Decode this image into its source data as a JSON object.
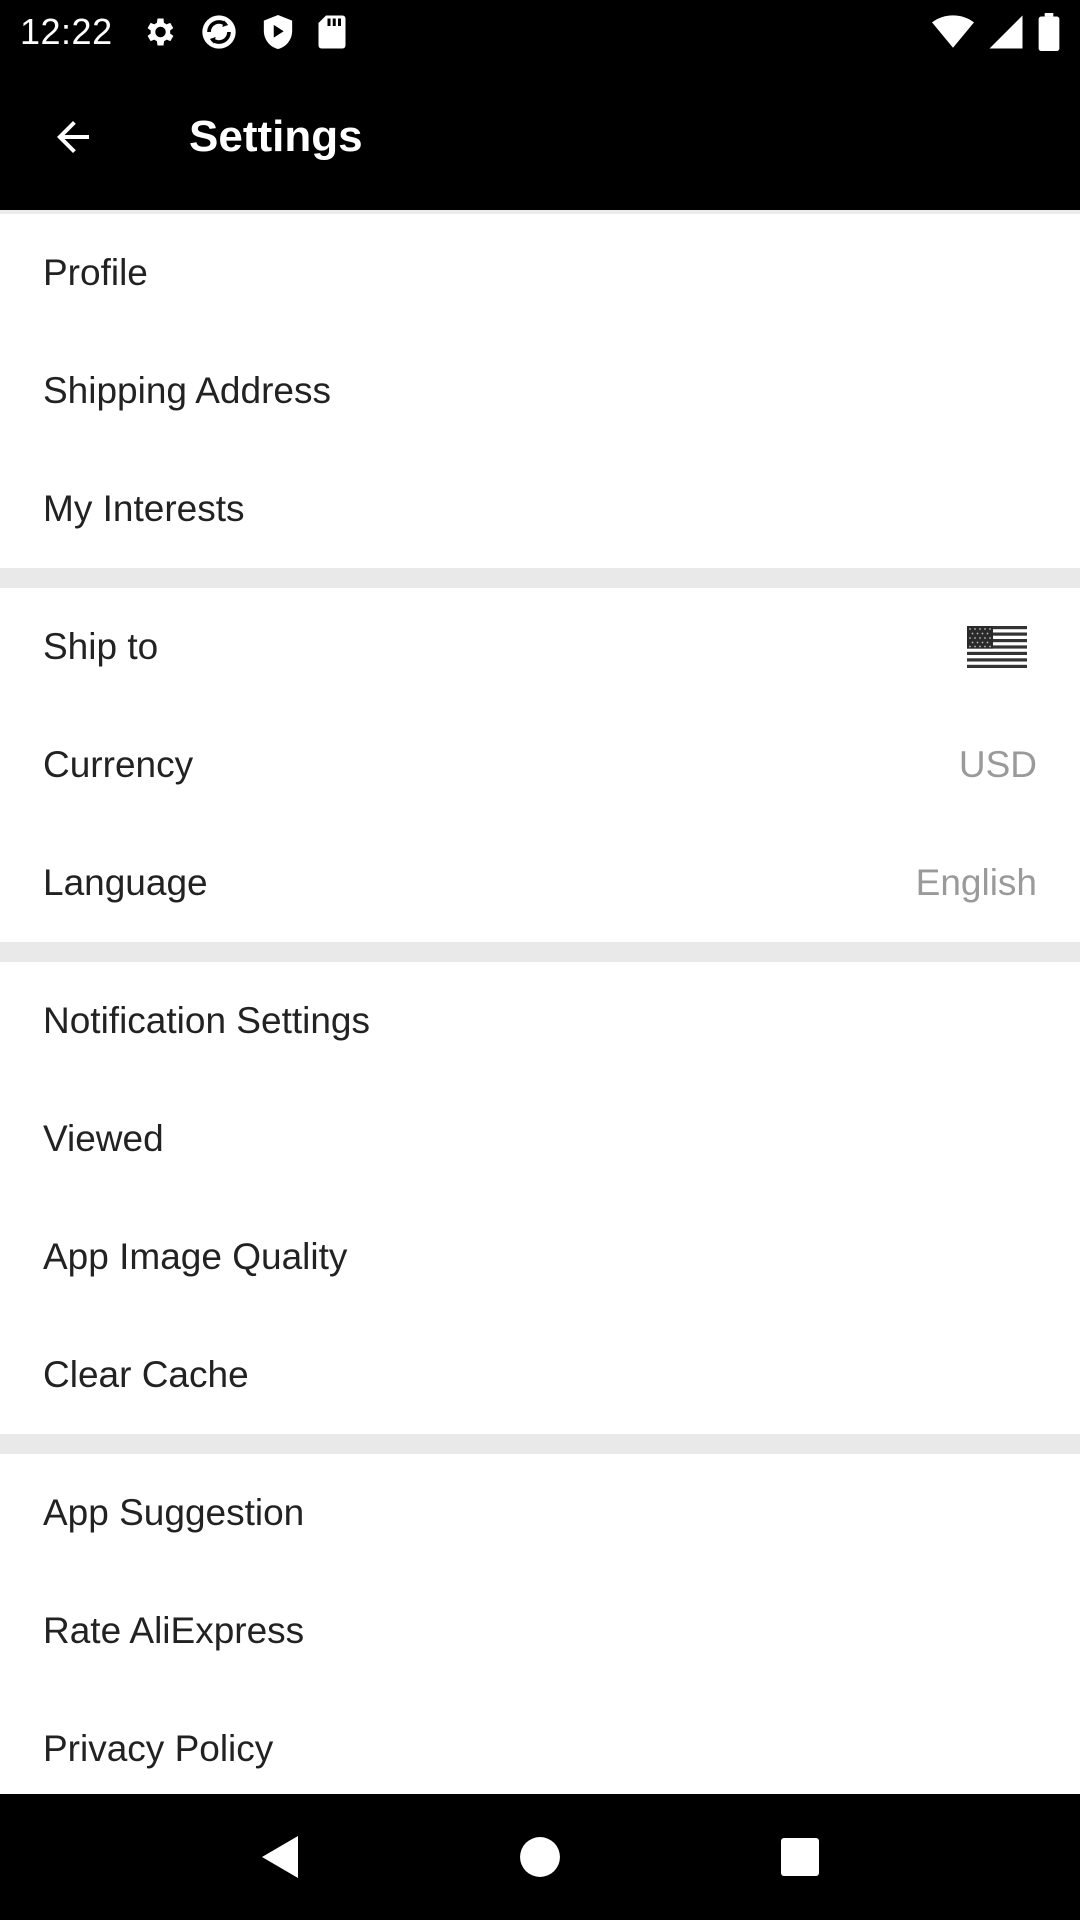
{
  "status_bar": {
    "time": "12:22",
    "left_icons": [
      "gear-icon",
      "sync-icon",
      "shield-icon",
      "sd-card-icon"
    ],
    "right_icons": [
      "wifi-icon",
      "signal-icon",
      "battery-icon"
    ]
  },
  "app_bar": {
    "title": "Settings",
    "back_icon": "arrow-left-icon"
  },
  "groups": [
    {
      "items": [
        {
          "label": "Profile"
        },
        {
          "label": "Shipping Address"
        },
        {
          "label": "My Interests"
        }
      ]
    },
    {
      "items": [
        {
          "label": "Ship to",
          "value_icon": "us-flag-icon"
        },
        {
          "label": "Currency",
          "value": "USD"
        },
        {
          "label": "Language",
          "value": "English"
        }
      ]
    },
    {
      "items": [
        {
          "label": "Notification Settings"
        },
        {
          "label": "Viewed"
        },
        {
          "label": "App Image Quality"
        },
        {
          "label": "Clear Cache"
        }
      ]
    },
    {
      "items": [
        {
          "label": "App Suggestion"
        },
        {
          "label": "Rate AliExpress"
        },
        {
          "label": "Privacy Policy"
        }
      ]
    }
  ],
  "nav_bar": {
    "buttons": [
      "back-triangle-icon",
      "home-circle-icon",
      "recents-square-icon"
    ]
  },
  "colors": {
    "bar_background": "#000000",
    "list_background": "#ffffff",
    "divider": "#e9e9e9",
    "label_text": "#222222",
    "value_text": "#9a9a9a"
  }
}
